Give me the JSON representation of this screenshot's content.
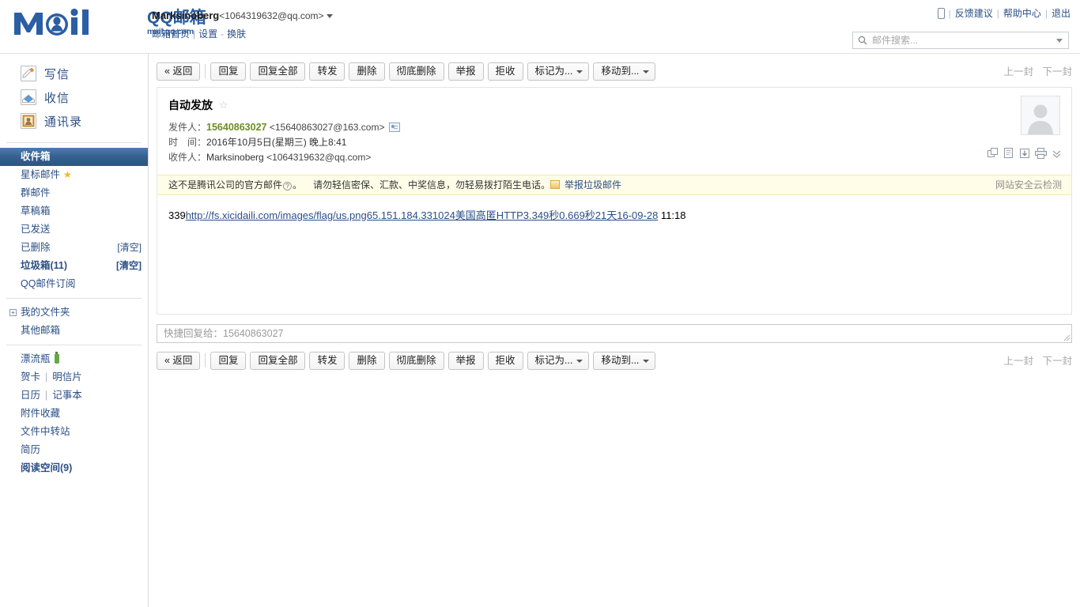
{
  "header": {
    "logo": {
      "wordmark": "Mail",
      "cn_title": "QQ邮箱",
      "cn_sub": "mail.qq.com"
    },
    "account": {
      "name": "Marksinoberg",
      "address": "<1064319632@qq.com>",
      "links": [
        {
          "label": "邮箱首页",
          "name": "mail-home-link"
        },
        {
          "label": "设置",
          "name": "settings-link"
        },
        {
          "label": "换肤",
          "name": "skin-link"
        }
      ]
    },
    "top_right": [
      {
        "label": "反馈建议",
        "name": "feedback-link"
      },
      {
        "label": "帮助中心",
        "name": "help-center-link"
      },
      {
        "label": "退出",
        "name": "logout-link"
      }
    ],
    "search": {
      "placeholder": "邮件搜索...",
      "value": ""
    }
  },
  "sidebar": {
    "main_nav": [
      {
        "label": "写信",
        "icon": "compose-icon"
      },
      {
        "label": "收信",
        "icon": "receive-icon"
      },
      {
        "label": "通讯录",
        "icon": "contacts-icon"
      }
    ],
    "folders": [
      {
        "label": "收件箱",
        "selected": true,
        "bold": false,
        "action": ""
      },
      {
        "label": "星标邮件",
        "selected": false,
        "bold": false,
        "action": "",
        "star": true
      },
      {
        "label": "群邮件",
        "selected": false,
        "bold": false,
        "action": ""
      },
      {
        "label": "草稿箱",
        "selected": false,
        "bold": false,
        "action": ""
      },
      {
        "label": "已发送",
        "selected": false,
        "bold": false,
        "action": ""
      },
      {
        "label": "已删除",
        "selected": false,
        "bold": false,
        "action": "[清空]"
      },
      {
        "label": "垃圾箱(11)",
        "selected": false,
        "bold": true,
        "action": "[清空]"
      },
      {
        "label": "QQ邮件订阅",
        "selected": false,
        "bold": false,
        "action": ""
      }
    ],
    "my_folder": {
      "label": "我的文件夹",
      "expander": "+"
    },
    "other_mailbox": {
      "label": "其他邮箱"
    },
    "tools": [
      {
        "label": "漂流瓶",
        "bottle": true
      },
      {
        "label": "贺卡",
        "label2": "明信片"
      },
      {
        "label": "日历",
        "label2": "记事本"
      },
      {
        "label": "附件收藏"
      },
      {
        "label": "文件中转站"
      },
      {
        "label": "简历"
      },
      {
        "label": "阅读空间(9)",
        "bold": true
      }
    ]
  },
  "toolbar": {
    "back": "« 返回",
    "buttons": [
      {
        "label": "回复",
        "name": "reply-button",
        "caret": false
      },
      {
        "label": "回复全部",
        "name": "reply-all-button",
        "caret": false
      },
      {
        "label": "转发",
        "name": "forward-button",
        "caret": false
      },
      {
        "label": "删除",
        "name": "delete-button",
        "caret": false
      },
      {
        "label": "彻底删除",
        "name": "delete-permanently-button",
        "caret": false
      },
      {
        "label": "举报",
        "name": "report-button",
        "caret": false
      },
      {
        "label": "拒收",
        "name": "block-button",
        "caret": false
      },
      {
        "label": "标记为...",
        "name": "mark-as-dropdown",
        "caret": true
      },
      {
        "label": "移动到...",
        "name": "move-to-dropdown",
        "caret": true
      }
    ],
    "prev": "上一封",
    "next": "下一封"
  },
  "mail": {
    "subject": "自动发放",
    "from_label": "发件人：",
    "from_name": "15640863027",
    "from_address": "<15640863027@163.com>",
    "time_label": "时　间：",
    "time_value": "2016年10月5日(星期三) 晚上8:41",
    "to_label": "收件人：",
    "to_name": "Marksinoberg",
    "to_address": "<1064319632@qq.com>",
    "warning": {
      "text_1": "这不是腾讯公司的官方邮件",
      "mark": "?",
      "text_2": "。",
      "text_3": "请勿轻信密保、汇款、中奖信息，勿轻易拨打陌生电话。",
      "report_link": "举报垃圾邮件",
      "right_label": "网站安全云检测"
    },
    "body": {
      "prefix": "339",
      "link": "http://fs.xicidaili.com/images/flag/us.png65.151.184.331024美国高匿HTTP3.349秒0.669秒21天16-09-28",
      "suffix": " 11:18"
    },
    "quick_reply_placeholder": "快捷回复给：15640863027"
  }
}
